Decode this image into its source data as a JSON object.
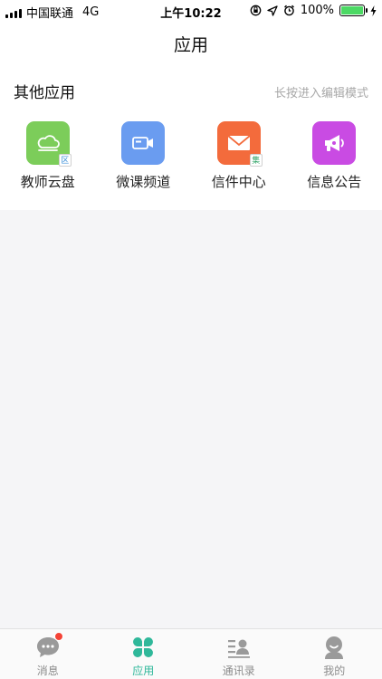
{
  "status_bar": {
    "carrier": "中国联通",
    "network": "4G",
    "time": "上午10:22",
    "battery_percent": "100%",
    "battery_level": 1.0
  },
  "nav": {
    "title": "应用"
  },
  "section": {
    "title": "其他应用",
    "hint": "长按进入编辑模式"
  },
  "apps": [
    {
      "label": "教师云盘",
      "icon": "cloud-drive-icon",
      "color": "#7ccd5a",
      "badge": "区"
    },
    {
      "label": "微课频道",
      "icon": "video-camera-icon",
      "color": "#6a9cf0",
      "badge": ""
    },
    {
      "label": "信件中心",
      "icon": "mail-icon",
      "color": "#f36b3c",
      "badge": "集"
    },
    {
      "label": "信息公告",
      "icon": "megaphone-icon",
      "color": "#c94be3",
      "badge": ""
    }
  ],
  "tabs": [
    {
      "label": "消息",
      "icon": "chat-bubble-icon",
      "active": false,
      "has_dot": true
    },
    {
      "label": "应用",
      "icon": "clover-icon",
      "active": true,
      "has_dot": false
    },
    {
      "label": "通讯录",
      "icon": "contacts-icon",
      "active": false,
      "has_dot": false
    },
    {
      "label": "我的",
      "icon": "user-icon",
      "active": false,
      "has_dot": false
    }
  ],
  "colors": {
    "accent": "#2fb89a",
    "inactive": "#8c8c8c",
    "notification": "#f44336"
  }
}
